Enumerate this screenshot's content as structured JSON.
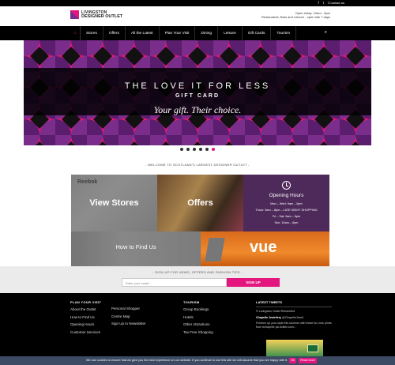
{
  "topbar": {
    "contact_label": "Contact us",
    "social": [
      "f",
      "t",
      "i"
    ],
    "social_icons": [
      "facebook-icon",
      "twitter-icon",
      "instagram-icon"
    ]
  },
  "header": {
    "logo_line1": "LIVINGSTON",
    "logo_line2": "DESIGNER OUTLET",
    "opening_line1": "Open today: 10am - 6pm",
    "opening_line2": "Restaurants, Bars and Leisure - open late 7 days"
  },
  "nav": {
    "home_icon": "home-icon",
    "items": [
      "Stores",
      "Offers",
      "All the Latest",
      "Plan Your Visit",
      "Dining",
      "Leisure",
      "Gift Cards",
      "Tourism"
    ],
    "search_icon": "search-icon"
  },
  "hero": {
    "title": "THE LOVE IT FOR LESS",
    "subtitle": "GIFT CARD",
    "tagline": "Your gift. Their choice."
  },
  "carousel": {
    "count": 6,
    "active_index": 5
  },
  "welcome": "- WELCOME TO SCOTLAND'S LARGEST DESIGNER OUTLET -",
  "tiles": {
    "stores_label": "View Stores",
    "stores_brand": "Reebok",
    "offers_label": "Offers",
    "hours": {
      "title": "Opening Hours",
      "lines": [
        "Mon – Wed: 9am – 6pm",
        "Thurs: 9am – 8pm – LATE NIGHT SHOPPING",
        "Fri – Sat: 9am – 6pm",
        "Sun: 10am – 6pm"
      ]
    },
    "find_label": "How to Find Us",
    "vue_label": "vue"
  },
  "signup": {
    "caption": "- SIGN UP FOR NEWS, OFFERS AND FASHION TIPS -",
    "placeholder": "Enter your email...",
    "button_label": "SIGN UP"
  },
  "footer": {
    "col1": {
      "heading": "PLAN YOUR VISIT",
      "links": [
        "About the Outlet",
        "How to Find Us",
        "Opening Hours",
        "Customer Services"
      ]
    },
    "col2": {
      "heading": "",
      "links": [
        "Personal Shopper",
        "Centre Map",
        "Sign Up to Newsletter"
      ]
    },
    "col3": {
      "heading": "TOURISM",
      "links": [
        "Group Bookings",
        "Hotels",
        "Other Attractions",
        "Tax Free Shopping"
      ]
    },
    "tweets": {
      "heading": "LATEST TWEETS",
      "retweet": "Livingston Outlet Retweeted",
      "author": "Chapelle Jewellery",
      "handle": "@ChapelleJewel",
      "text": "Freshen up your style this summer with these fun new prints from #chapelle pic.twitter.com/..."
    }
  },
  "cookie": {
    "text": "We use cookies to ensure that we give you the best experience on our website. If you continue to use this site we will assume that you are happy with it.",
    "ok_label": "Ok",
    "more_label": "Read more"
  },
  "colors": {
    "brand_pink": "#e4177f",
    "brand_purple": "#7b2d8b",
    "hours_purple": "#4d2a5a",
    "cookie_bar": "#3c4a63"
  }
}
